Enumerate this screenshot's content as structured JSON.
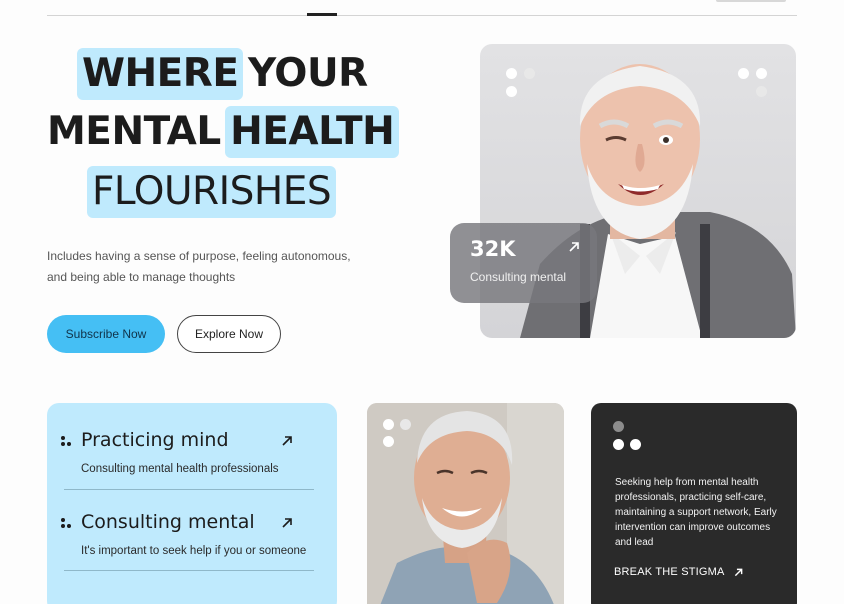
{
  "hero": {
    "headline": {
      "line1_highlight": "WHERE",
      "line1_rest": "YOUR",
      "line2_start": "MENTAL",
      "line2_highlight": "HEALTH",
      "line3_highlight": "FLOURISHES"
    },
    "description_line1": "Includes having a sense of purpose, feeling autonomous,",
    "description_line2": "and being able to manage thoughts",
    "subscribe_label": "Subscribe Now",
    "explore_label": "Explore Now"
  },
  "stat": {
    "value": "32K",
    "label": "Consulting mental",
    "icon": "arrow-up-right-icon"
  },
  "features": [
    {
      "title": "Practicing mind",
      "subtitle": "Consulting mental health professionals",
      "icon": "dots-icon"
    },
    {
      "title": "Consulting mental",
      "subtitle": "It's important to seek help if you or someone",
      "icon": "dots-icon"
    }
  ],
  "dark_card": {
    "text": "Seeking help from mental health professionals, practicing self-care, maintaining a support network, Early intervention can improve outcomes and lead",
    "link_label": "BREAK THE STIGMA"
  },
  "colors": {
    "accent": "#45bff4",
    "highlight": "#bfeafd",
    "dark": "#2a2a2a"
  }
}
